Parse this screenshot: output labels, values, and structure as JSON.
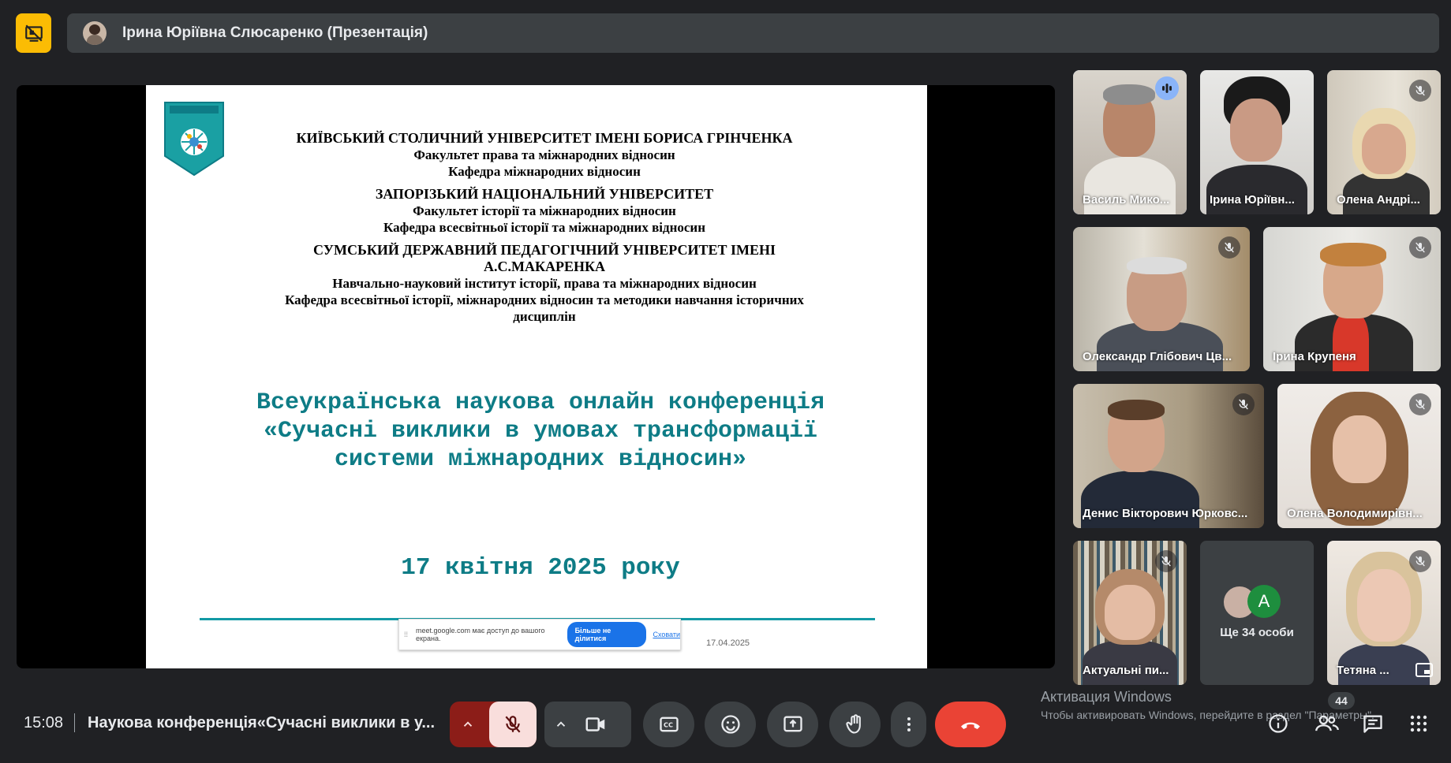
{
  "top": {
    "presenter_name": "Ірина Юріївна Слюсаренко (Презентація)"
  },
  "slide": {
    "blocks": [
      {
        "l1": "КИЇВСЬКИЙ СТОЛИЧНИЙ УНІВЕРСИТЕТ ІМЕНІ БОРИСА ГРІНЧЕНКА",
        "l2": "Факультет права та міжнародних відносин",
        "l3": "Кафедра міжнародних відносин"
      },
      {
        "l1": "ЗАПОРІЗЬКИЙ НАЦІОНАЛЬНИЙ УНІВЕРСИТЕТ",
        "l2": "Факультет історії та міжнародних відносин",
        "l3": "Кафедра всесвітньої історії та міжнародних відносин"
      },
      {
        "l1": "СУМСЬКИЙ ДЕРЖАВНИЙ ПЕДАГОГІЧНИЙ УНІВЕРСИТЕТ ІМЕНІ",
        "l1b": "А.С.МАКАРЕНКА",
        "l2": "Навчально-науковий інститут історії, права та міжнародних відносин",
        "l3": "Кафедра всесвітньої історії, міжнародних відносин та методики навчання історичних",
        "l4": "дисциплін"
      }
    ],
    "conf_title_1": "Всеукраїнська наукова онлайн конференція",
    "conf_title_2": "«Сучасні виклики в умовах трансформації",
    "conf_title_3": "системи міжнародних відносин»",
    "conf_date": "17 квітня 2025 року",
    "footer_date": "17.04.2025",
    "share_bar": {
      "message": "meet.google.com має доступ до вашого екрана.",
      "stop_label": "Більше не ділитися",
      "hide_label": "Сховати"
    }
  },
  "participants": [
    {
      "name": "Василь Мико...",
      "speaking": true
    },
    {
      "name": "Ірина Юріївн...",
      "muted": false
    },
    {
      "name": "Олена Андрі...",
      "muted": true
    },
    {
      "name": "Олександр Глібович Цв...",
      "muted": true
    },
    {
      "name": "Ірина Крупеня",
      "muted": true
    },
    {
      "name": "Денис Вікторович Юрковс...",
      "muted": true
    },
    {
      "name": "Олена Володимирівн...",
      "muted": true
    },
    {
      "name": "Актуальні пи...",
      "muted": true
    },
    {
      "name": "Ще 34 особи",
      "avatar_letter": "А"
    },
    {
      "name": "Тетяна ...",
      "muted": true
    }
  ],
  "windows_activation": {
    "line1": "Активация Windows",
    "line2": "Чтобы активировать Windows, перейдите в раздел \"Параметры\"."
  },
  "bottom": {
    "time": "15:08",
    "meeting_title": "Наукова конференція«Сучасні виклики в у...",
    "people_count": "44"
  },
  "colors": {
    "background": "#202124",
    "accent_teal": "#0e7c86",
    "hangup_red": "#ea4335",
    "mic_muted_bg": "#f9dedc",
    "speaking_blue": "#8ab4f8"
  }
}
